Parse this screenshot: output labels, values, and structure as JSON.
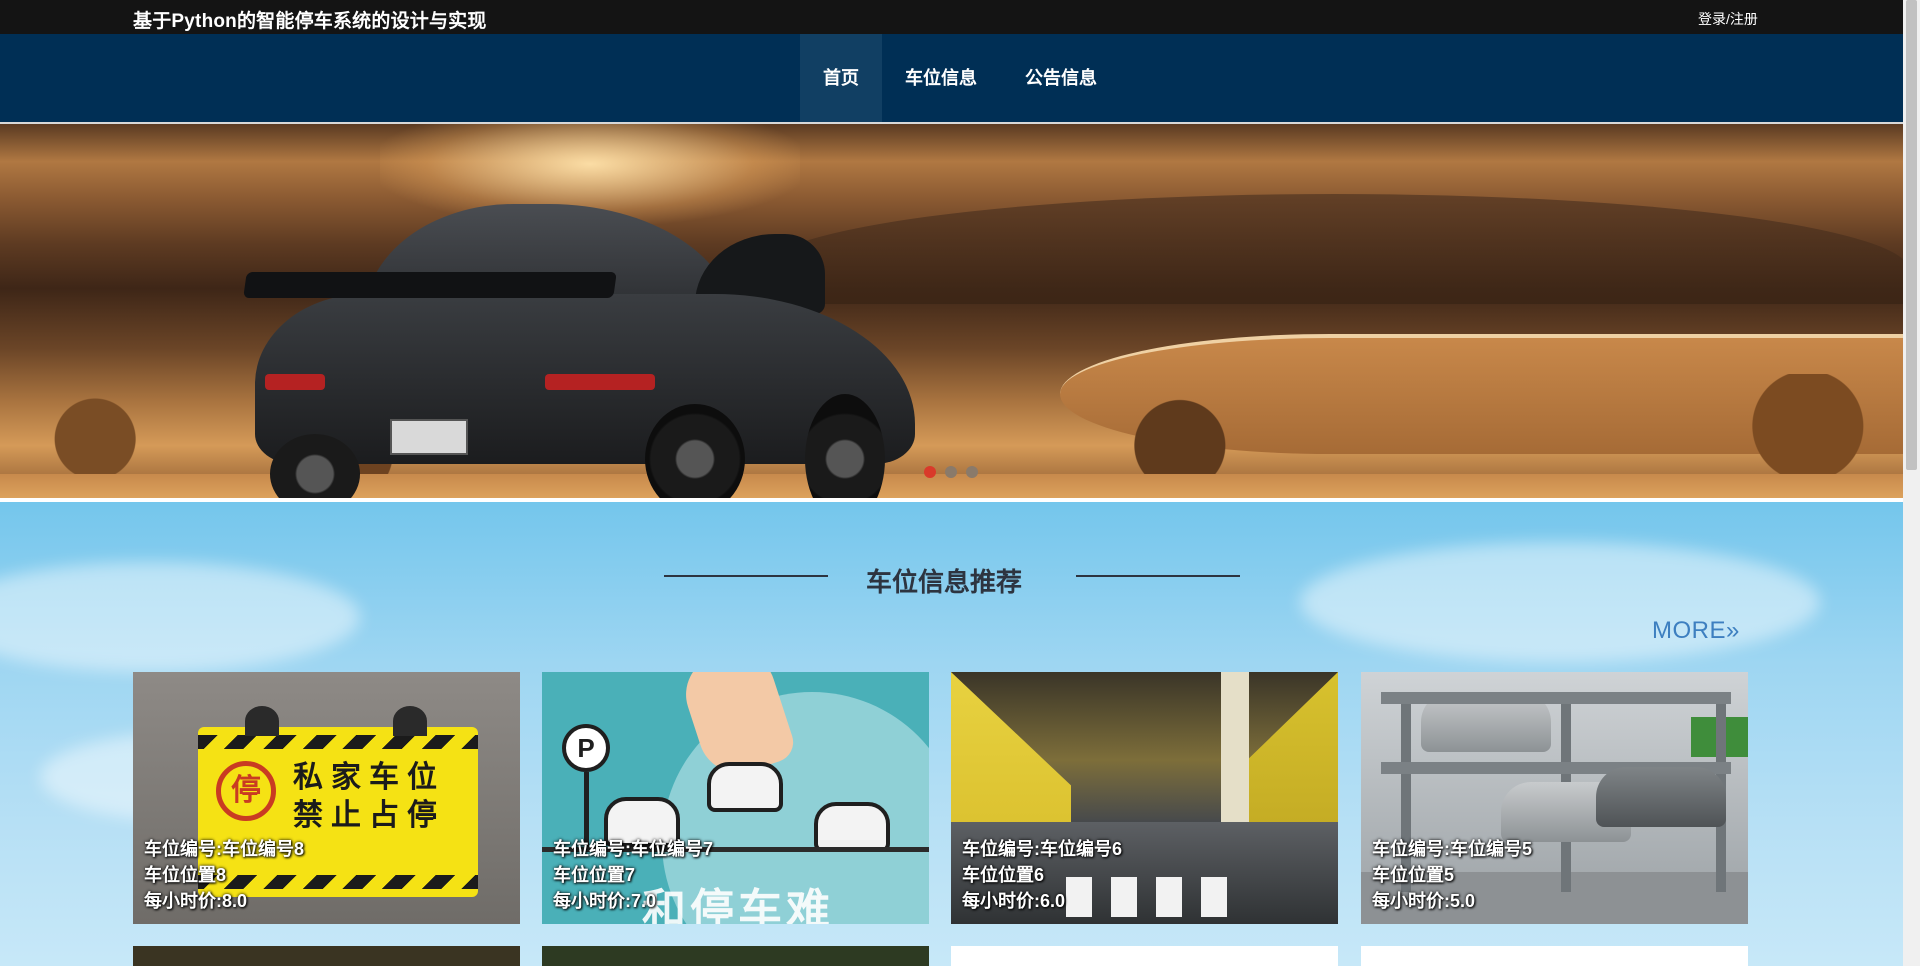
{
  "header": {
    "site_title": "基于Python的智能停车系统的设计与实现",
    "login_label": "登录/注册"
  },
  "nav": {
    "items": [
      {
        "label": "首页",
        "active": true
      },
      {
        "label": "车位信息",
        "active": false
      },
      {
        "label": "公告信息",
        "active": false
      }
    ]
  },
  "banner": {
    "slides_count": 3,
    "active_slide": 1
  },
  "recommend": {
    "title": "车位信息推荐",
    "more_label": "MORE",
    "more_icon": "double-chevron-right-icon",
    "cards": [
      {
        "id_line": "车位编号:车位编号8",
        "location": "车位位置8",
        "price": "每小时价:8.0",
        "sign_char": "停",
        "sign_text": "私家车位禁止占停"
      },
      {
        "id_line": "车位编号:车位编号7",
        "location": "车位位置7",
        "price": "每小时价:7.0",
        "pin_char": "P",
        "big_text": "和停车难"
      },
      {
        "id_line": "车位编号:车位编号6",
        "location": "车位位置6",
        "price": "每小时价:6.0"
      },
      {
        "id_line": "车位编号:车位编号5",
        "location": "车位位置5",
        "price": "每小时价:5.0"
      }
    ]
  },
  "colors": {
    "topbar_bg": "#141414",
    "nav_bg": "#002f55",
    "nav_active_bg": "#113f63",
    "accent_more": "#3d7fc0",
    "slide_dot_active": "#d93a2a"
  }
}
